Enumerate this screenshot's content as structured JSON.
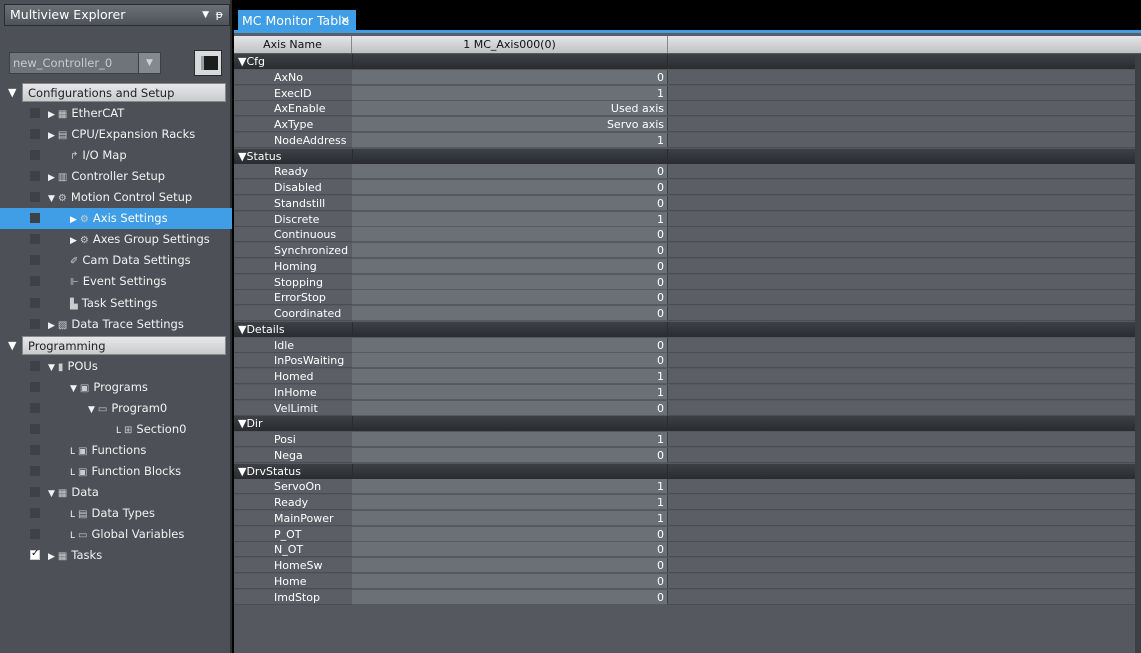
{
  "explorer": {
    "title": "Multiview Explorer",
    "pin_glyph": "ᵽ",
    "controller": "new_Controller_0",
    "tree": [
      {
        "label": "Configurations and Setup",
        "type": "group",
        "arrow": "▼"
      },
      {
        "label": "EtherCAT",
        "indent": 1,
        "arrow": "▶",
        "icon": "▦"
      },
      {
        "label": "CPU/Expansion Racks",
        "indent": 1,
        "arrow": "▶",
        "icon": "▤"
      },
      {
        "label": "I/O Map",
        "indent": 2,
        "arrow": "",
        "icon": "↱"
      },
      {
        "label": "Controller Setup",
        "indent": 1,
        "arrow": "▶",
        "icon": "▥"
      },
      {
        "label": "Motion Control Setup",
        "indent": 1,
        "arrow": "▼",
        "icon": "⚙"
      },
      {
        "label": "Axis Settings",
        "indent": 2,
        "arrow": "▶",
        "icon": "⚙",
        "selected": true
      },
      {
        "label": "Axes Group Settings",
        "indent": 2,
        "arrow": "▶",
        "icon": "⚙"
      },
      {
        "label": "Cam Data Settings",
        "indent": 2,
        "arrow": "",
        "icon": "✐"
      },
      {
        "label": "Event Settings",
        "indent": 2,
        "arrow": "",
        "icon": "⊩"
      },
      {
        "label": "Task Settings",
        "indent": 2,
        "arrow": "",
        "icon": "▙"
      },
      {
        "label": "Data Trace Settings",
        "indent": 1,
        "arrow": "▶",
        "icon": "▧"
      },
      {
        "label": "Programming",
        "type": "group",
        "arrow": "▼"
      },
      {
        "label": "POUs",
        "indent": 1,
        "arrow": "▼",
        "icon": "▮"
      },
      {
        "label": "Programs",
        "indent": 2,
        "arrow": "▼",
        "icon": "▣"
      },
      {
        "label": "Program0",
        "indent": 3,
        "arrow": "▼",
        "icon": "▭"
      },
      {
        "label": "Section0",
        "indent": 4,
        "arrow": "L",
        "icon": "⊞"
      },
      {
        "label": "Functions",
        "indent": 2,
        "arrow": "L",
        "icon": "▣"
      },
      {
        "label": "Function Blocks",
        "indent": 2,
        "arrow": "L",
        "icon": "▣"
      },
      {
        "label": "Data",
        "indent": 1,
        "arrow": "▼",
        "icon": "▦"
      },
      {
        "label": "Data Types",
        "indent": 2,
        "arrow": "L",
        "icon": "▤"
      },
      {
        "label": "Global Variables",
        "indent": 2,
        "arrow": "L",
        "icon": "▭"
      },
      {
        "label": "Tasks",
        "indent": 1,
        "arrow": "▶",
        "icon": "▦",
        "checked": true
      }
    ]
  },
  "editor": {
    "tab_label": "MC Monitor Table",
    "close_glyph": "×",
    "header": {
      "col1": "Axis Name",
      "col2": "1 MC_Axis000(0)"
    },
    "sections": [
      {
        "name": "Cfg",
        "rows": [
          [
            "AxNo",
            "0"
          ],
          [
            "ExecID",
            "1"
          ],
          [
            "AxEnable",
            "Used axis"
          ],
          [
            "AxType",
            "Servo axis"
          ],
          [
            "NodeAddress",
            "1"
          ]
        ]
      },
      {
        "name": "Status",
        "rows": [
          [
            "Ready",
            "0"
          ],
          [
            "Disabled",
            "0"
          ],
          [
            "Standstill",
            "0"
          ],
          [
            "Discrete",
            "1"
          ],
          [
            "Continuous",
            "0"
          ],
          [
            "Synchronized",
            "0"
          ],
          [
            "Homing",
            "0"
          ],
          [
            "Stopping",
            "0"
          ],
          [
            "ErrorStop",
            "0"
          ],
          [
            "Coordinated",
            "0"
          ]
        ]
      },
      {
        "name": "Details",
        "rows": [
          [
            "Idle",
            "0"
          ],
          [
            "InPosWaiting",
            "0"
          ],
          [
            "Homed",
            "1"
          ],
          [
            "InHome",
            "1"
          ],
          [
            "VelLimit",
            "0"
          ]
        ]
      },
      {
        "name": "Dir",
        "rows": [
          [
            "Posi",
            "1"
          ],
          [
            "Nega",
            "0"
          ]
        ]
      },
      {
        "name": "DrvStatus",
        "rows": [
          [
            "ServoOn",
            "1"
          ],
          [
            "Ready",
            "1"
          ],
          [
            "MainPower",
            "1"
          ],
          [
            "P_OT",
            "0"
          ],
          [
            "N_OT",
            "0"
          ],
          [
            "HomeSw",
            "0"
          ],
          [
            "Home",
            "0"
          ],
          [
            "ImdStop",
            "0"
          ]
        ]
      }
    ]
  }
}
